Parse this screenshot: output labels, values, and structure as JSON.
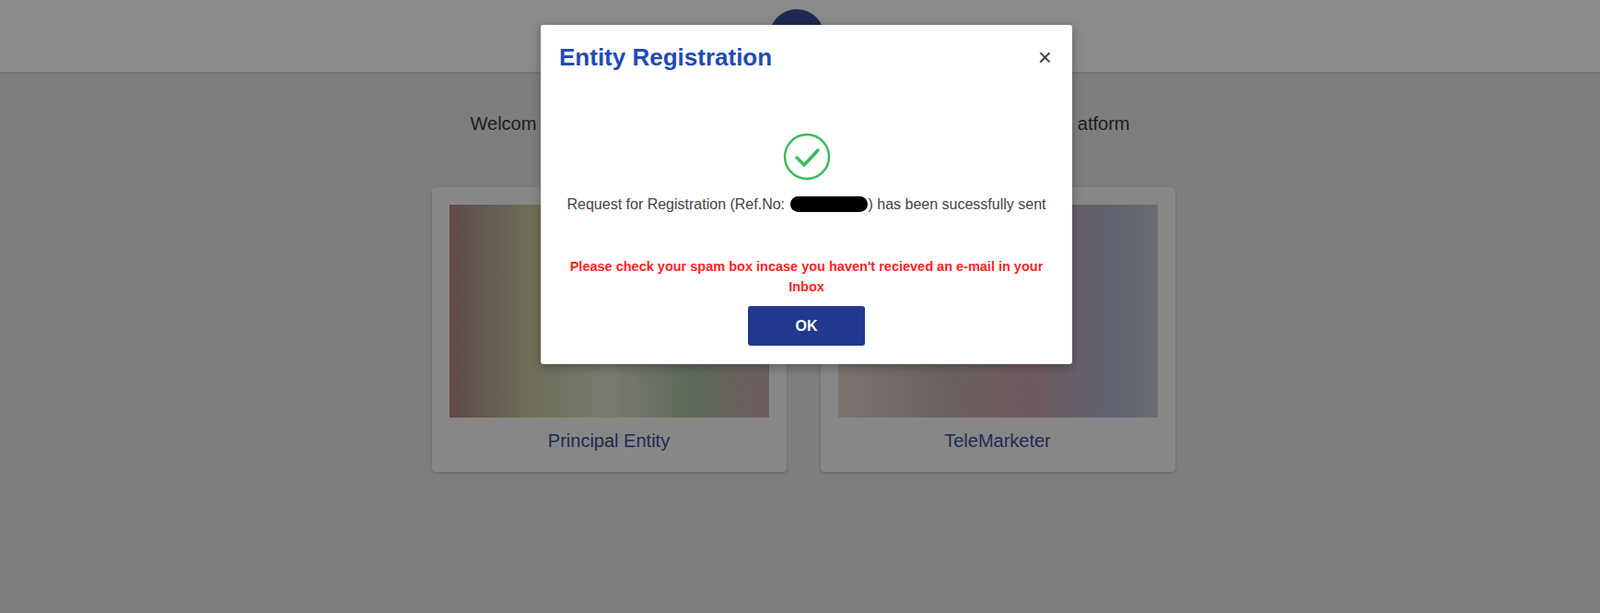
{
  "page": {
    "welcome_left": "Welcom",
    "welcome_right": "atform"
  },
  "cards": [
    {
      "label": "Principal Entity"
    },
    {
      "label": "TeleMarketer"
    }
  ],
  "dialog": {
    "title": "Entity Registration",
    "close": "×",
    "message_before": "Request for Registration (Ref.No: ",
    "message_after": ") has been sucessfully sent",
    "warning": "Please check your spam box incase you haven't recieved an e-mail in your Inbox",
    "buttons": [
      "OK"
    ]
  }
}
